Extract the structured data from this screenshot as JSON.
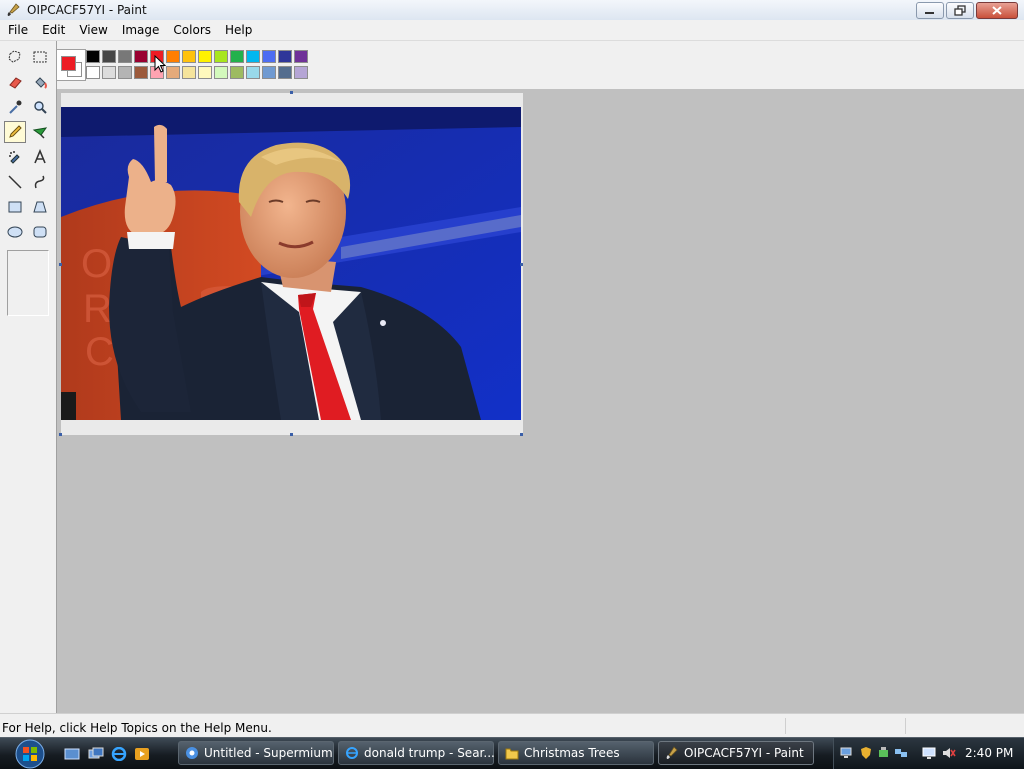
{
  "window": {
    "title": "OIPCACF57YI - Paint",
    "app_icon": "paint-brush-icon",
    "controls": [
      "minimize-icon",
      "restore-icon",
      "close-icon"
    ]
  },
  "menu": [
    "File",
    "Edit",
    "View",
    "Image",
    "Colors",
    "Help"
  ],
  "tools": [
    {
      "name": "free-form-select",
      "icon": "free-form-select-icon"
    },
    {
      "name": "select",
      "icon": "rectangle-select-icon"
    },
    {
      "name": "eraser",
      "icon": "eraser-icon"
    },
    {
      "name": "fill",
      "icon": "fill-bucket-icon"
    },
    {
      "name": "pick-color",
      "icon": "eyedropper-icon"
    },
    {
      "name": "magnifier",
      "icon": "magnifier-icon"
    },
    {
      "name": "pencil",
      "icon": "pencil-icon",
      "selected": true
    },
    {
      "name": "brush",
      "icon": "brush-icon"
    },
    {
      "name": "airbrush",
      "icon": "airbrush-icon"
    },
    {
      "name": "text",
      "icon": "text-icon"
    },
    {
      "name": "line",
      "icon": "line-icon"
    },
    {
      "name": "curve",
      "icon": "curve-icon"
    },
    {
      "name": "rectangle",
      "icon": "rectangle-icon"
    },
    {
      "name": "polygon",
      "icon": "polygon-icon"
    },
    {
      "name": "ellipse",
      "icon": "ellipse-icon"
    },
    {
      "name": "rounded-rectangle",
      "icon": "rounded-rectangle-icon"
    }
  ],
  "colors": {
    "foreground": "#ed1c24",
    "background": "#ffffff",
    "palette_top": [
      "#000000",
      "#464646",
      "#787878",
      "#990030",
      "#ed1c24",
      "#ff7e00",
      "#ffc20e",
      "#fff200",
      "#a8e61d",
      "#22b14c",
      "#00b7ef",
      "#4d6df3",
      "#2f3699",
      "#6f3198"
    ],
    "palette_bottom": [
      "#ffffff",
      "#dcdcdc",
      "#b4b4b4",
      "#9c5a3c",
      "#ffa3b1",
      "#e5aa7a",
      "#f5e49c",
      "#fff9bd",
      "#d3f9bc",
      "#9dbb61",
      "#99d9ea",
      "#709ad1",
      "#546d8e",
      "#b5a5d5"
    ]
  },
  "canvas": {
    "image_icon": "photo-of-man-giving-thumbs-up"
  },
  "status": {
    "text": "For Help, click Help Topics on the Help Menu."
  },
  "taskbar": {
    "start_icon": "windows-start-orb-icon",
    "quick_launch": [
      "show-desktop-icon",
      "switch-windows-icon",
      "internet-explorer-icon",
      "media-player-icon"
    ],
    "buttons": [
      {
        "label": "Untitled - Supermium",
        "icon": "browser-icon",
        "active": false
      },
      {
        "label": "donald trump - Sear...",
        "icon": "internet-explorer-icon",
        "active": false
      },
      {
        "label": "Christmas Trees",
        "icon": "folder-icon",
        "active": false
      },
      {
        "label": "OIPCACF57YI - Paint",
        "icon": "paint-brush-icon",
        "active": true
      }
    ],
    "tray_icons": [
      "network-icon",
      "security-shield-icon",
      "safely-remove-icon",
      "network-connections-icon",
      "monitor-icon",
      "volume-muted-icon"
    ],
    "clock": "2:40 PM"
  }
}
